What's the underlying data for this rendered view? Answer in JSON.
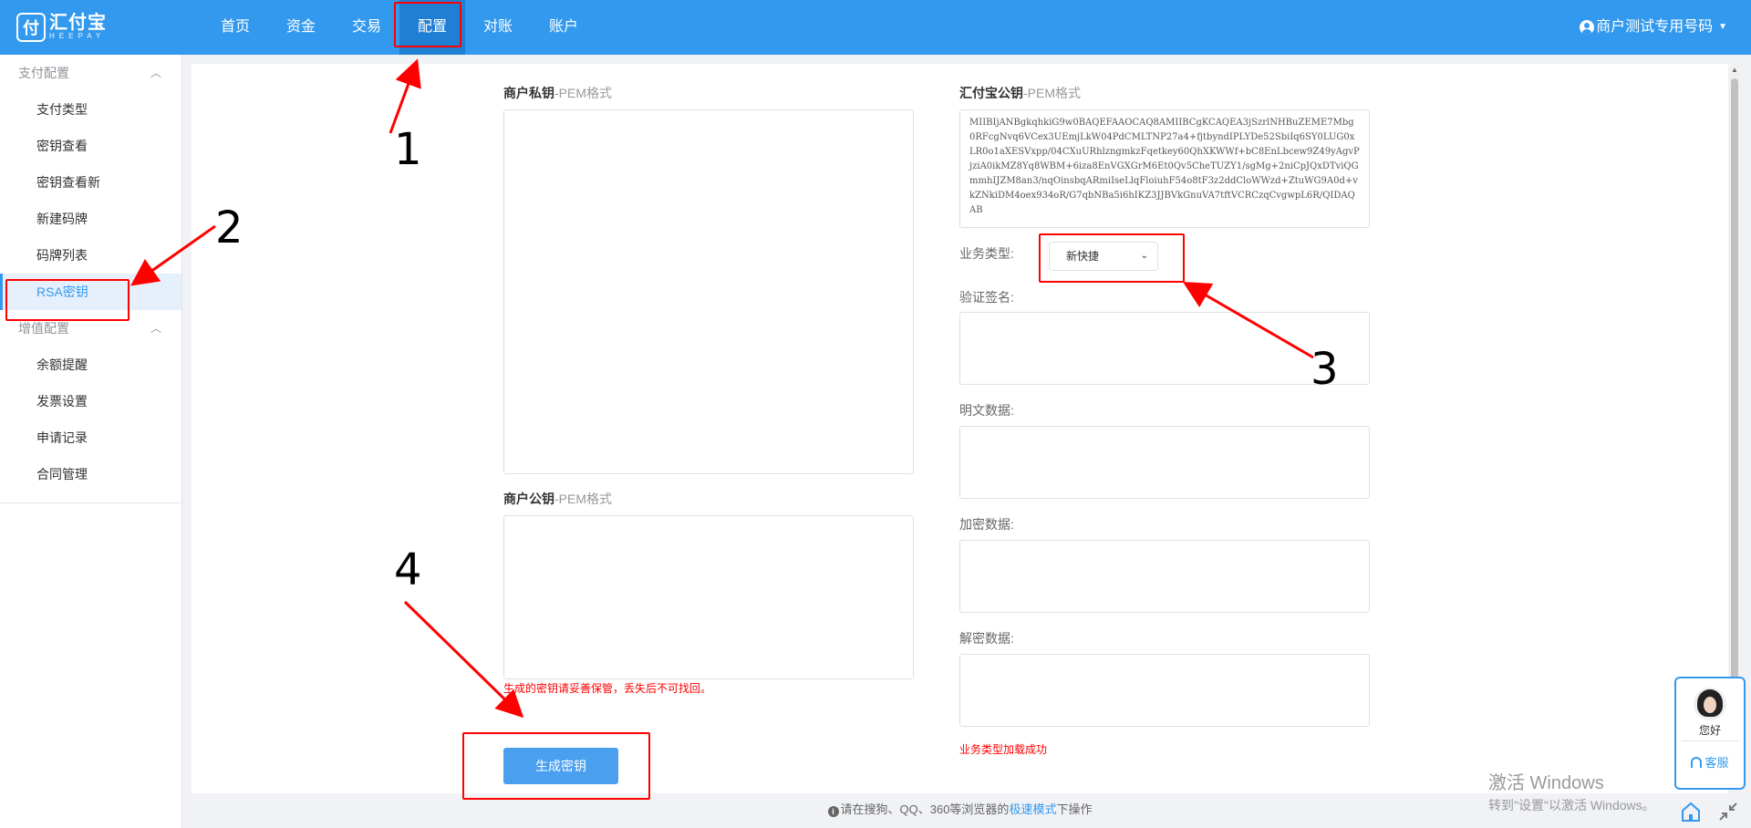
{
  "brand": {
    "name_cn": "汇付宝",
    "name_en": "HEEPAY",
    "mark": "付"
  },
  "nav": {
    "items": [
      {
        "label": "首页"
      },
      {
        "label": "资金"
      },
      {
        "label": "交易"
      },
      {
        "label": "配置",
        "active": true
      },
      {
        "label": "对账"
      },
      {
        "label": "账户"
      }
    ]
  },
  "user": {
    "name": "商户测试专用号码"
  },
  "sidebar": {
    "groups": [
      {
        "title": "支付配置",
        "items": [
          "支付类型",
          "密钥查看",
          "密钥查看新",
          "新建码牌",
          "码牌列表",
          "RSA密钥"
        ]
      },
      {
        "title": "增值配置",
        "items": [
          "余额提醒",
          "发票设置",
          "申请记录",
          "合同管理"
        ]
      }
    ],
    "active_item": "RSA密钥"
  },
  "form": {
    "merchant_private_key": {
      "label": "商户私钥",
      "hint": "-PEM格式",
      "value": ""
    },
    "merchant_public_key": {
      "label": "商户公钥",
      "hint": "-PEM格式",
      "value": ""
    },
    "heepay_public_key": {
      "label": "汇付宝公钥",
      "hint": "-PEM格式",
      "value": "MIIBIjANBgkqhkiG9w0BAQEFAAOCAQ8AMIIBCgKCAQEA3jSzrlNHBuZEME7Mbg0RFcgNvq6VCex3UEmjLkW04PdCMLTNP27a4+fjtbyndIPLYDe52SbiIq6SY0LUG0xLR0o1aXESVxpp/04CXuURhlzngmkzFqetkey60QhXKWWf+bC8EnLbcew9Z49yAgvPjziA0ikMZ8Yq8WBM+6iza8EnVGXGrM6Et0Qv5CheTUZY1/sgMg+2niCpJQxDTviQGmmhIJZM8an3/nqOinsbqARmiIseLlqFloiuhF54o8tF3z2ddCloWWzd+ZtuWG9A0d+vkZNkiDM4oex934oR/G7qbNBa5i6hIKZ3JJBVkGnuVA7tftVCRCzqCvgwpL6R/QIDAQAB"
    },
    "biz_type": {
      "label": "业务类型:",
      "value": "新快捷"
    },
    "verify_sign": {
      "label": "验证签名:"
    },
    "plain_data": {
      "label": "明文数据:"
    },
    "encrypted_data": {
      "label": "加密数据:"
    },
    "decrypted_data": {
      "label": "解密数据:"
    },
    "save_warning": "生成的密钥请妥善保管，丢失后不可找回。",
    "load_success": "业务类型加载成功",
    "generate_button": "生成密钥"
  },
  "footer": {
    "prefix": "请在搜狗、QQ、360等浏览器的",
    "link": "极速模式",
    "suffix": "下操作"
  },
  "annotations": [
    "1",
    "2",
    "3",
    "4"
  ],
  "customer_service": {
    "greeting": "您好",
    "service": "客服"
  },
  "watermark": {
    "title": "激活 Windows",
    "subtitle": "转到\"设置\"以激活 Windows。"
  },
  "icons": [
    "user-icon",
    "chevron-up-icon",
    "chevron-down-icon",
    "info-icon",
    "headset-icon",
    "home-icon",
    "shrink-icon"
  ],
  "colors": {
    "primary": "#3399ee",
    "nav_active": "#1f7fd4",
    "annotation": "#ff0000",
    "warning": "#ff0000"
  }
}
